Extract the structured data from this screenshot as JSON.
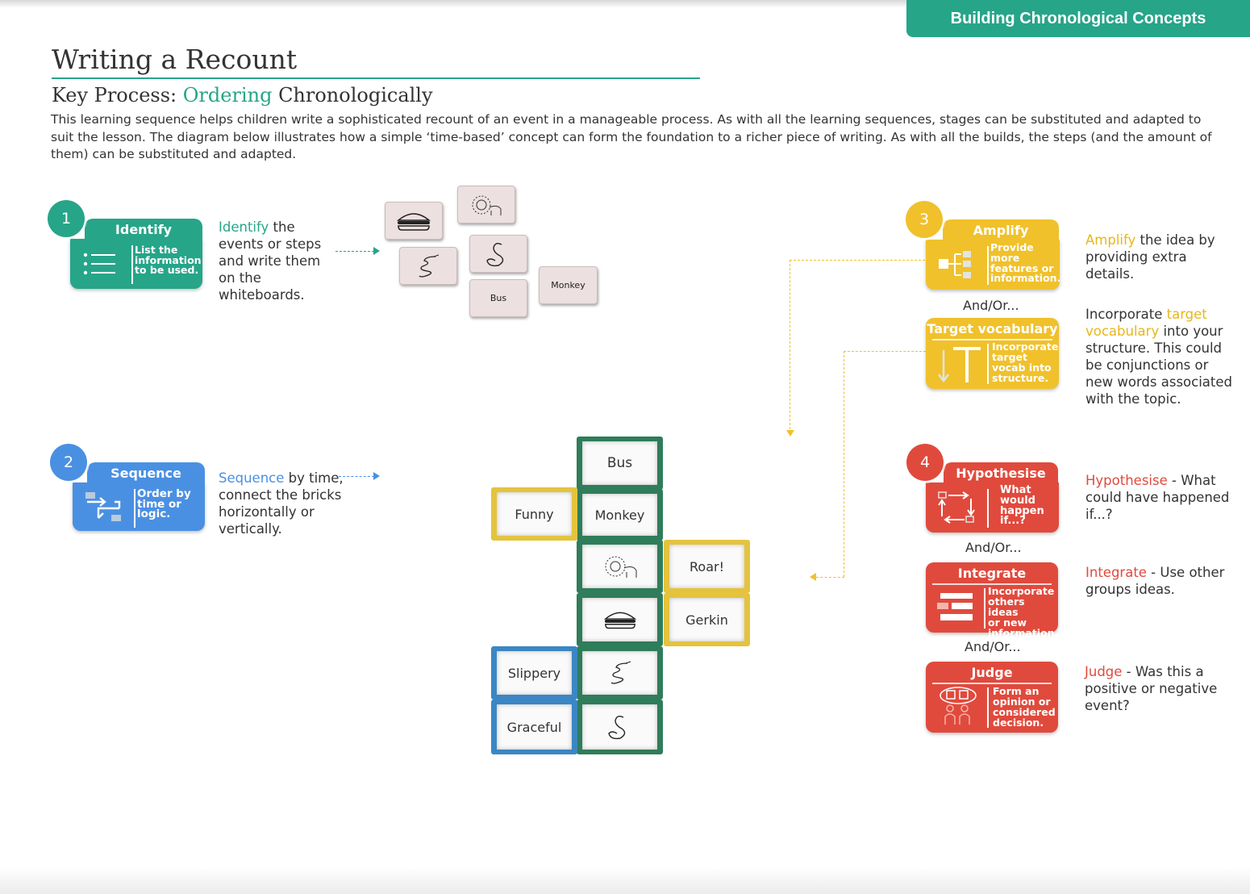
{
  "banner": "Building Chronological Concepts",
  "title": "Writing a Recount",
  "subtitle": {
    "prefix": "Key Process: ",
    "highlight": "Ordering",
    "suffix": " Chronologically"
  },
  "intro": "This learning sequence helps children write a sophisticated recount of an event in a manageable process. As with all the learning sequences, stages can be substituted and adapted to suit the lesson. The diagram below illustrates how a simple ‘time-based’ concept can form the foundation to a richer piece of writing. As with all the builds, the steps (and the amount of them) can be substituted and adapted.",
  "colors": {
    "green": "#26a589",
    "blue": "#4a90e2",
    "yellow": "#f0c12b",
    "red": "#e04a3d"
  },
  "steps": {
    "identify": {
      "number": "1",
      "title": "Identify",
      "card_line1": "List the",
      "card_line2": "information",
      "card_line3": "to be used.",
      "icon": "list-icon",
      "text_highlight": "Identify",
      "text_rest": " the events or steps and write them on the whiteboards."
    },
    "sequence": {
      "number": "2",
      "title": "Sequence",
      "card_line1": "Order by",
      "card_line2": "time or",
      "card_line3": "logic.",
      "icon": "sequence-icon",
      "text_highlight": "Sequence",
      "text_rest": " by time, connect the bricks horizontally or vertically."
    },
    "amplify": {
      "number": "3",
      "title": "Amplify",
      "card_line1": "Provide",
      "card_line2": "more",
      "card_line3": "features or",
      "card_line4": "information.",
      "icon": "hierarchy-icon",
      "text_highlight": "Amplify",
      "text_rest": " the idea by providing extra details."
    },
    "target_vocabulary": {
      "title": "Target vocabulary",
      "card_line1": "Incorporate",
      "card_line2": "target",
      "card_line3": "vocab into",
      "card_line4": "structure.",
      "icon": "text-t-icon",
      "text_pre": "Incorporate ",
      "text_highlight": "target vocabulary",
      "text_rest": " into your structure. This could be conjunctions or new words associated with the topic."
    },
    "hypothesise": {
      "number": "4",
      "title": "Hypothesise",
      "card_line1": "What",
      "card_line2": "would",
      "card_line3": "happen",
      "card_line4": "if...?",
      "icon": "cycle-icon",
      "text_highlight": "Hypothesise",
      "text_rest": " - What could have happened if...?"
    },
    "integrate": {
      "title": "Integrate",
      "card_line1": "Incorporate",
      "card_line2": "others ideas",
      "card_line3": "or new",
      "card_line4": "information.",
      "icon": "merge-icon",
      "text_highlight": "Integrate",
      "text_rest": " - Use other groups ideas."
    },
    "judge": {
      "title": "Judge",
      "card_line1": "Form an",
      "card_line2": "opinion or",
      "card_line3": "considered",
      "card_line4": "decision.",
      "icon": "discussion-icon",
      "text_highlight": "Judge",
      "text_rest": " - Was this a positive or negative event?"
    }
  },
  "andor": [
    "And/Or...",
    "And/Or...",
    "And/Or..."
  ],
  "whiteboards": {
    "bus": "Bus",
    "monkey": "Monkey"
  },
  "bricks": {
    "bus": "Bus",
    "monkey": "Monkey",
    "funny": "Funny",
    "roar": "Roar!",
    "gerkin": "Gerkin",
    "slippery": "Slippery",
    "graceful": "Graceful"
  }
}
